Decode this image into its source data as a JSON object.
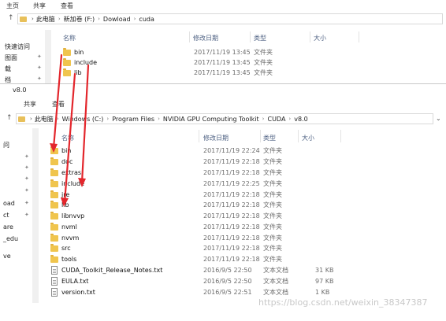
{
  "top_window": {
    "ribbon_tabs": [
      "主页",
      "共享",
      "查看"
    ],
    "breadcrumb": [
      "此电脑",
      "新加卷 (F:)",
      "Dowload",
      "cuda"
    ],
    "columns": [
      "名称",
      "修改日期",
      "类型",
      "大小"
    ],
    "left_pane": [
      "快速访问",
      "图面",
      "载",
      "档"
    ],
    "rows": [
      {
        "name": "bin",
        "date": "2017/11/19 13:45",
        "type": "文件夹",
        "size": ""
      },
      {
        "name": "include",
        "date": "2017/11/19 13:45",
        "type": "文件夹",
        "size": ""
      },
      {
        "name": "lib",
        "date": "2017/11/19 13:45",
        "type": "文件夹",
        "size": ""
      }
    ]
  },
  "bottom_window": {
    "title": "v8.0",
    "ribbon_tabs": [
      "共享",
      "查看"
    ],
    "breadcrumb": [
      "此电脑",
      "Windows (C:)",
      "Program Files",
      "NVIDIA GPU Computing Toolkit",
      "CUDA",
      "v8.0"
    ],
    "columns": [
      "名称",
      "修改日期",
      "类型",
      "大小"
    ],
    "left_pane": [
      "问",
      "oad",
      "ct",
      "are",
      "_edu",
      "ve"
    ],
    "rows": [
      {
        "name": "bin",
        "date": "2017/11/19 22:24",
        "type": "文件夹",
        "size": "",
        "kind": "folder"
      },
      {
        "name": "doc",
        "date": "2017/11/19 22:18",
        "type": "文件夹",
        "size": "",
        "kind": "folder"
      },
      {
        "name": "extras",
        "date": "2017/11/19 22:18",
        "type": "文件夹",
        "size": "",
        "kind": "folder"
      },
      {
        "name": "include",
        "date": "2017/11/19 22:25",
        "type": "文件夹",
        "size": "",
        "kind": "folder"
      },
      {
        "name": "jre",
        "date": "2017/11/19 22:18",
        "type": "文件夹",
        "size": "",
        "kind": "folder"
      },
      {
        "name": "lib",
        "date": "2017/11/19 22:18",
        "type": "文件夹",
        "size": "",
        "kind": "folder"
      },
      {
        "name": "libnvvp",
        "date": "2017/11/19 22:18",
        "type": "文件夹",
        "size": "",
        "kind": "folder"
      },
      {
        "name": "nvml",
        "date": "2017/11/19 22:18",
        "type": "文件夹",
        "size": "",
        "kind": "folder"
      },
      {
        "name": "nvvm",
        "date": "2017/11/19 22:18",
        "type": "文件夹",
        "size": "",
        "kind": "folder"
      },
      {
        "name": "src",
        "date": "2017/11/19 22:18",
        "type": "文件夹",
        "size": "",
        "kind": "folder"
      },
      {
        "name": "tools",
        "date": "2017/11/19 22:18",
        "type": "文件夹",
        "size": "",
        "kind": "folder"
      },
      {
        "name": "CUDA_Toolkit_Release_Notes.txt",
        "date": "2016/9/5 22:50",
        "type": "文本文档",
        "size": "31 KB",
        "kind": "file"
      },
      {
        "name": "EULA.txt",
        "date": "2016/9/5 22:50",
        "type": "文本文档",
        "size": "97 KB",
        "kind": "file"
      },
      {
        "name": "version.txt",
        "date": "2016/9/5 22:51",
        "type": "文本文档",
        "size": "1 KB",
        "kind": "file"
      }
    ]
  },
  "watermark": "https://blog.csdn.net/weixin_38347387",
  "colors": {
    "arrow": "#e3262c",
    "folder": "#f0c54e",
    "header_text": "#4d6082"
  }
}
